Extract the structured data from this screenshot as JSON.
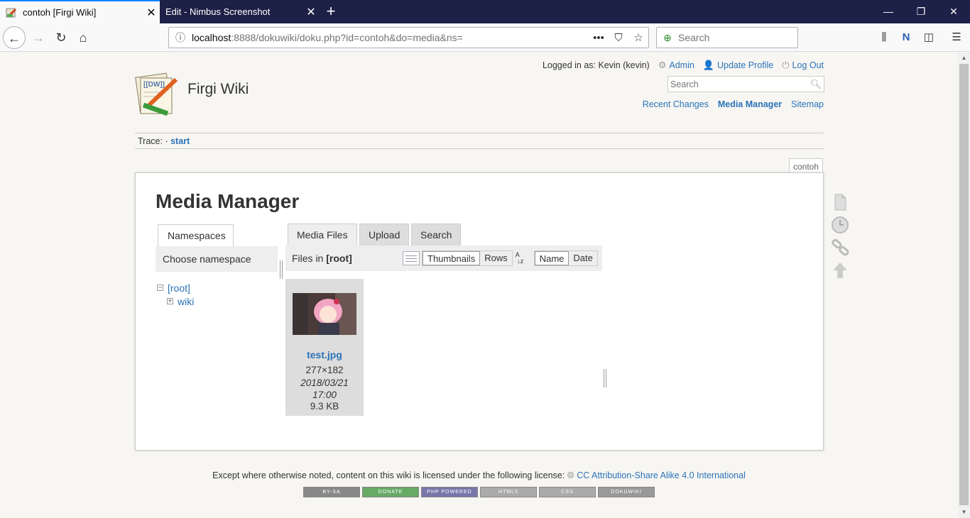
{
  "browser": {
    "tabs": [
      {
        "title": "contoh [Firgi Wiki]",
        "active": true
      },
      {
        "title": "Edit - Nimbus Screenshot",
        "active": false
      }
    ],
    "url_host": "localhost",
    "url_rest": ":8888/dokuwiki/doku.php?id=contoh&do=media&ns=",
    "search_placeholder": "Search",
    "accent": "#0a84ff",
    "tabbar_color": "#1d2047"
  },
  "wiki": {
    "site_name": "Firgi Wiki",
    "logged_in": "Logged in as: Kevin (kevin)",
    "user_tools": [
      "Admin",
      "Update Profile",
      "Log Out"
    ],
    "search_placeholder": "Search",
    "site_tools": [
      "Recent Changes",
      "Media Manager",
      "Sitemap"
    ],
    "trace_label": "Trace:",
    "trace_sep": "·",
    "trace_link": "start",
    "page_id": "contoh",
    "link_color": "#2b73b7"
  },
  "media_manager": {
    "heading": "Media Manager",
    "namespaces_tab": "Namespaces",
    "choose_namespace": "Choose namespace",
    "tree": [
      {
        "label": "[root]",
        "toggle": "−"
      },
      {
        "label": "wiki",
        "toggle": "+"
      }
    ],
    "file_tabs": [
      "Media Files",
      "Upload",
      "Search"
    ],
    "files_in_label": "Files in",
    "files_in_ns": "[root]",
    "view_options": [
      "Thumbnails",
      "Rows"
    ],
    "sort_options": [
      "Name",
      "Date"
    ],
    "files": [
      {
        "name": "test.jpg",
        "dimensions": "277×182",
        "date": "2018/03/21 17:00",
        "size": "9.3 KB"
      }
    ]
  },
  "footer": {
    "license_text": "Except where otherwise noted, content on this wiki is licensed under the following license:",
    "license_link": "CC Attribution-Share Alike 4.0 International",
    "badges": [
      "BY-SA",
      "DONATE",
      "PHP POWERED",
      "HTML5",
      "CSS",
      "DOKUWIKI"
    ]
  }
}
